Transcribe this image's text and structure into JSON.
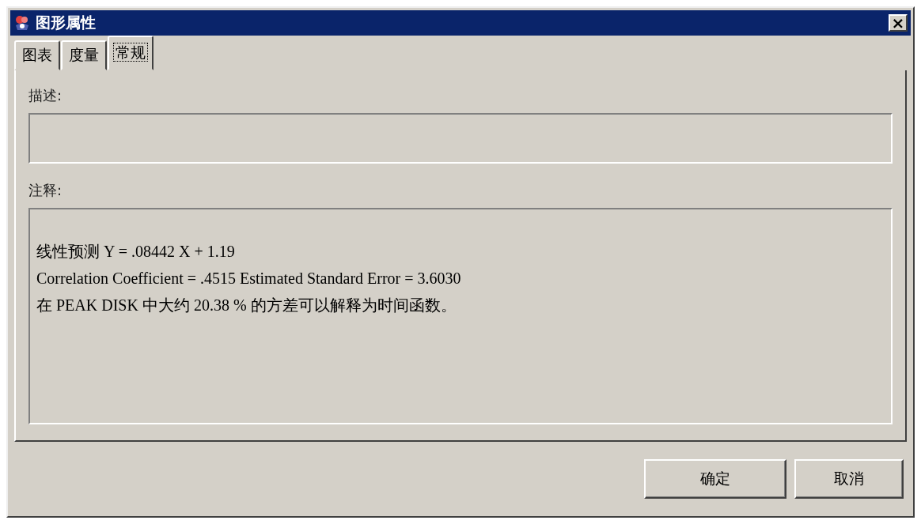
{
  "window": {
    "title": "图形属性",
    "close": "×"
  },
  "tabs": [
    {
      "label": "图表",
      "selected": false
    },
    {
      "label": "度量",
      "selected": false
    },
    {
      "label": "常规",
      "selected": true
    }
  ],
  "description": {
    "label": "描述:"
  },
  "notes": {
    "label": "注释:",
    "lines": [
      "线性预测 Y = .08442 X + 1.19",
      "Correlation Coefficient = .4515 Estimated Standard Error = 3.6030",
      "在 PEAK DISK 中大约 20.38 % 的方差可以解释为时间函数。"
    ]
  },
  "buttons": [
    "确定",
    "取消"
  ]
}
